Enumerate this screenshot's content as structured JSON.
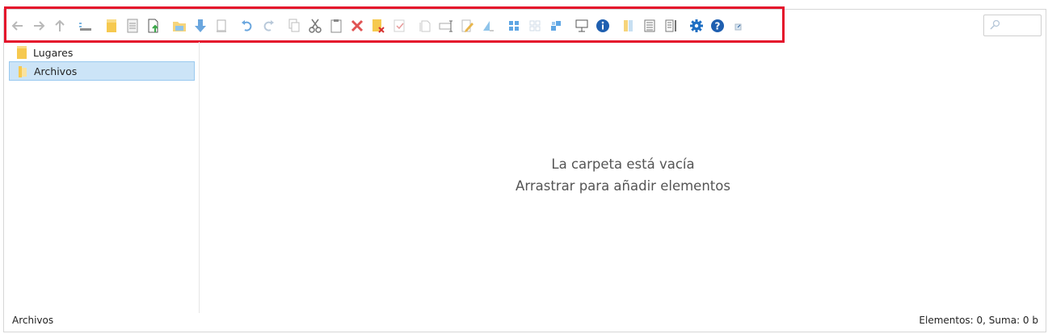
{
  "toolbar": {
    "buttons": [
      {
        "name": "back-arrow-icon"
      },
      {
        "name": "forward-arrow-icon"
      },
      {
        "name": "up-arrow-icon"
      },
      {
        "name": "view-icon"
      },
      {
        "name": "new-folder-icon"
      },
      {
        "name": "new-file-icon"
      },
      {
        "name": "upload-icon"
      },
      {
        "name": "open-folder-icon"
      },
      {
        "name": "download-icon"
      },
      {
        "name": "file-icon"
      },
      {
        "name": "undo-icon"
      },
      {
        "name": "redo-icon"
      },
      {
        "name": "copy-icon"
      },
      {
        "name": "cut-icon"
      },
      {
        "name": "paste-icon"
      },
      {
        "name": "delete-icon"
      },
      {
        "name": "empty-folder-icon"
      },
      {
        "name": "select-icon"
      },
      {
        "name": "duplicate-icon"
      },
      {
        "name": "rename-icon"
      },
      {
        "name": "edit-icon"
      },
      {
        "name": "resize-icon"
      },
      {
        "name": "grid-view-icon"
      },
      {
        "name": "small-icons-icon"
      },
      {
        "name": "list-view-icon"
      },
      {
        "name": "preview-icon"
      },
      {
        "name": "info-icon"
      },
      {
        "name": "columns-icon"
      },
      {
        "name": "details-icon"
      },
      {
        "name": "sort-icon"
      },
      {
        "name": "settings-icon"
      },
      {
        "name": "help-icon"
      },
      {
        "name": "fullscreen-icon"
      }
    ]
  },
  "colors": {
    "accent": "#e4112b",
    "selection": "#cce4f7",
    "folder": "#f6d47b",
    "blue": "#1f6fc3"
  },
  "tree": {
    "items": [
      {
        "label": "Lugares",
        "selected": false
      },
      {
        "label": "Archivos",
        "selected": true
      }
    ]
  },
  "main": {
    "empty_line1": "La carpeta está vacía",
    "empty_line2": "Arrastrar para añadir elementos"
  },
  "status": {
    "path": "Archivos",
    "summary": "Elementos: 0, Suma: 0 b"
  }
}
